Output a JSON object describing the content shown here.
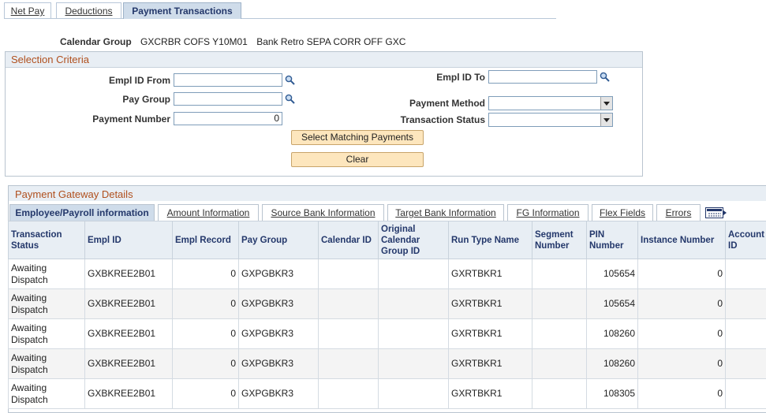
{
  "top_tabs": [
    {
      "label": "Net Pay",
      "active": false
    },
    {
      "label": "Deductions",
      "active": false
    },
    {
      "label": "Payment Transactions",
      "active": true
    }
  ],
  "calendar_group": {
    "label": "Calendar Group",
    "code": "GXCRBR COFS Y10M01",
    "description": "Bank Retro SEPA CORR OFF GXC"
  },
  "selection_criteria": {
    "title": "Selection Criteria",
    "empl_id_from": {
      "label": "Empl ID From",
      "value": ""
    },
    "empl_id_to": {
      "label": "Empl ID To",
      "value": ""
    },
    "pay_group": {
      "label": "Pay Group",
      "value": ""
    },
    "payment_method": {
      "label": "Payment Method",
      "value": ""
    },
    "payment_number": {
      "label": "Payment Number",
      "value": "0"
    },
    "transaction_status": {
      "label": "Transaction Status",
      "value": ""
    },
    "select_button": "Select Matching Payments",
    "clear_button": "Clear"
  },
  "gateway": {
    "title": "Payment Gateway Details",
    "tabs": [
      {
        "label": "Employee/Payroll information",
        "active": true
      },
      {
        "label": "Amount Information",
        "active": false
      },
      {
        "label": "Source Bank Information",
        "active": false
      },
      {
        "label": "Target Bank Information",
        "active": false
      },
      {
        "label": "FG Information",
        "active": false
      },
      {
        "label": "Flex Fields",
        "active": false
      },
      {
        "label": "Errors",
        "active": false
      }
    ],
    "show_all_icon": "show-all-columns-icon",
    "columns": [
      "Transaction Status",
      "Empl ID",
      "Empl Record",
      "Pay Group",
      "Calendar ID",
      "Original Calendar Group ID",
      "Run Type Name",
      "Segment Number",
      "PIN Number",
      "Instance Number",
      "Account ID"
    ],
    "rows": [
      [
        "Awaiting Dispatch",
        "GXBKREE2B01",
        "0",
        "GXPGBKR3",
        "",
        "",
        "GXRTBKR1",
        "",
        "105654",
        "0",
        ""
      ],
      [
        "Awaiting Dispatch",
        "GXBKREE2B01",
        "0",
        "GXPGBKR3",
        "",
        "",
        "GXRTBKR1",
        "",
        "105654",
        "0",
        ""
      ],
      [
        "Awaiting Dispatch",
        "GXBKREE2B01",
        "0",
        "GXPGBKR3",
        "",
        "",
        "GXRTBKR1",
        "",
        "108260",
        "0",
        ""
      ],
      [
        "Awaiting Dispatch",
        "GXBKREE2B01",
        "0",
        "GXPGBKR3",
        "",
        "",
        "GXRTBKR1",
        "",
        "108260",
        "0",
        ""
      ],
      [
        "Awaiting Dispatch",
        "GXBKREE2B01",
        "0",
        "GXPGBKR3",
        "",
        "",
        "GXRTBKR1",
        "",
        "108305",
        "0",
        ""
      ]
    ]
  },
  "colors": {
    "accent_title": "#b0501e",
    "header_text": "#24386b",
    "button_bg": "#fde6bd"
  }
}
